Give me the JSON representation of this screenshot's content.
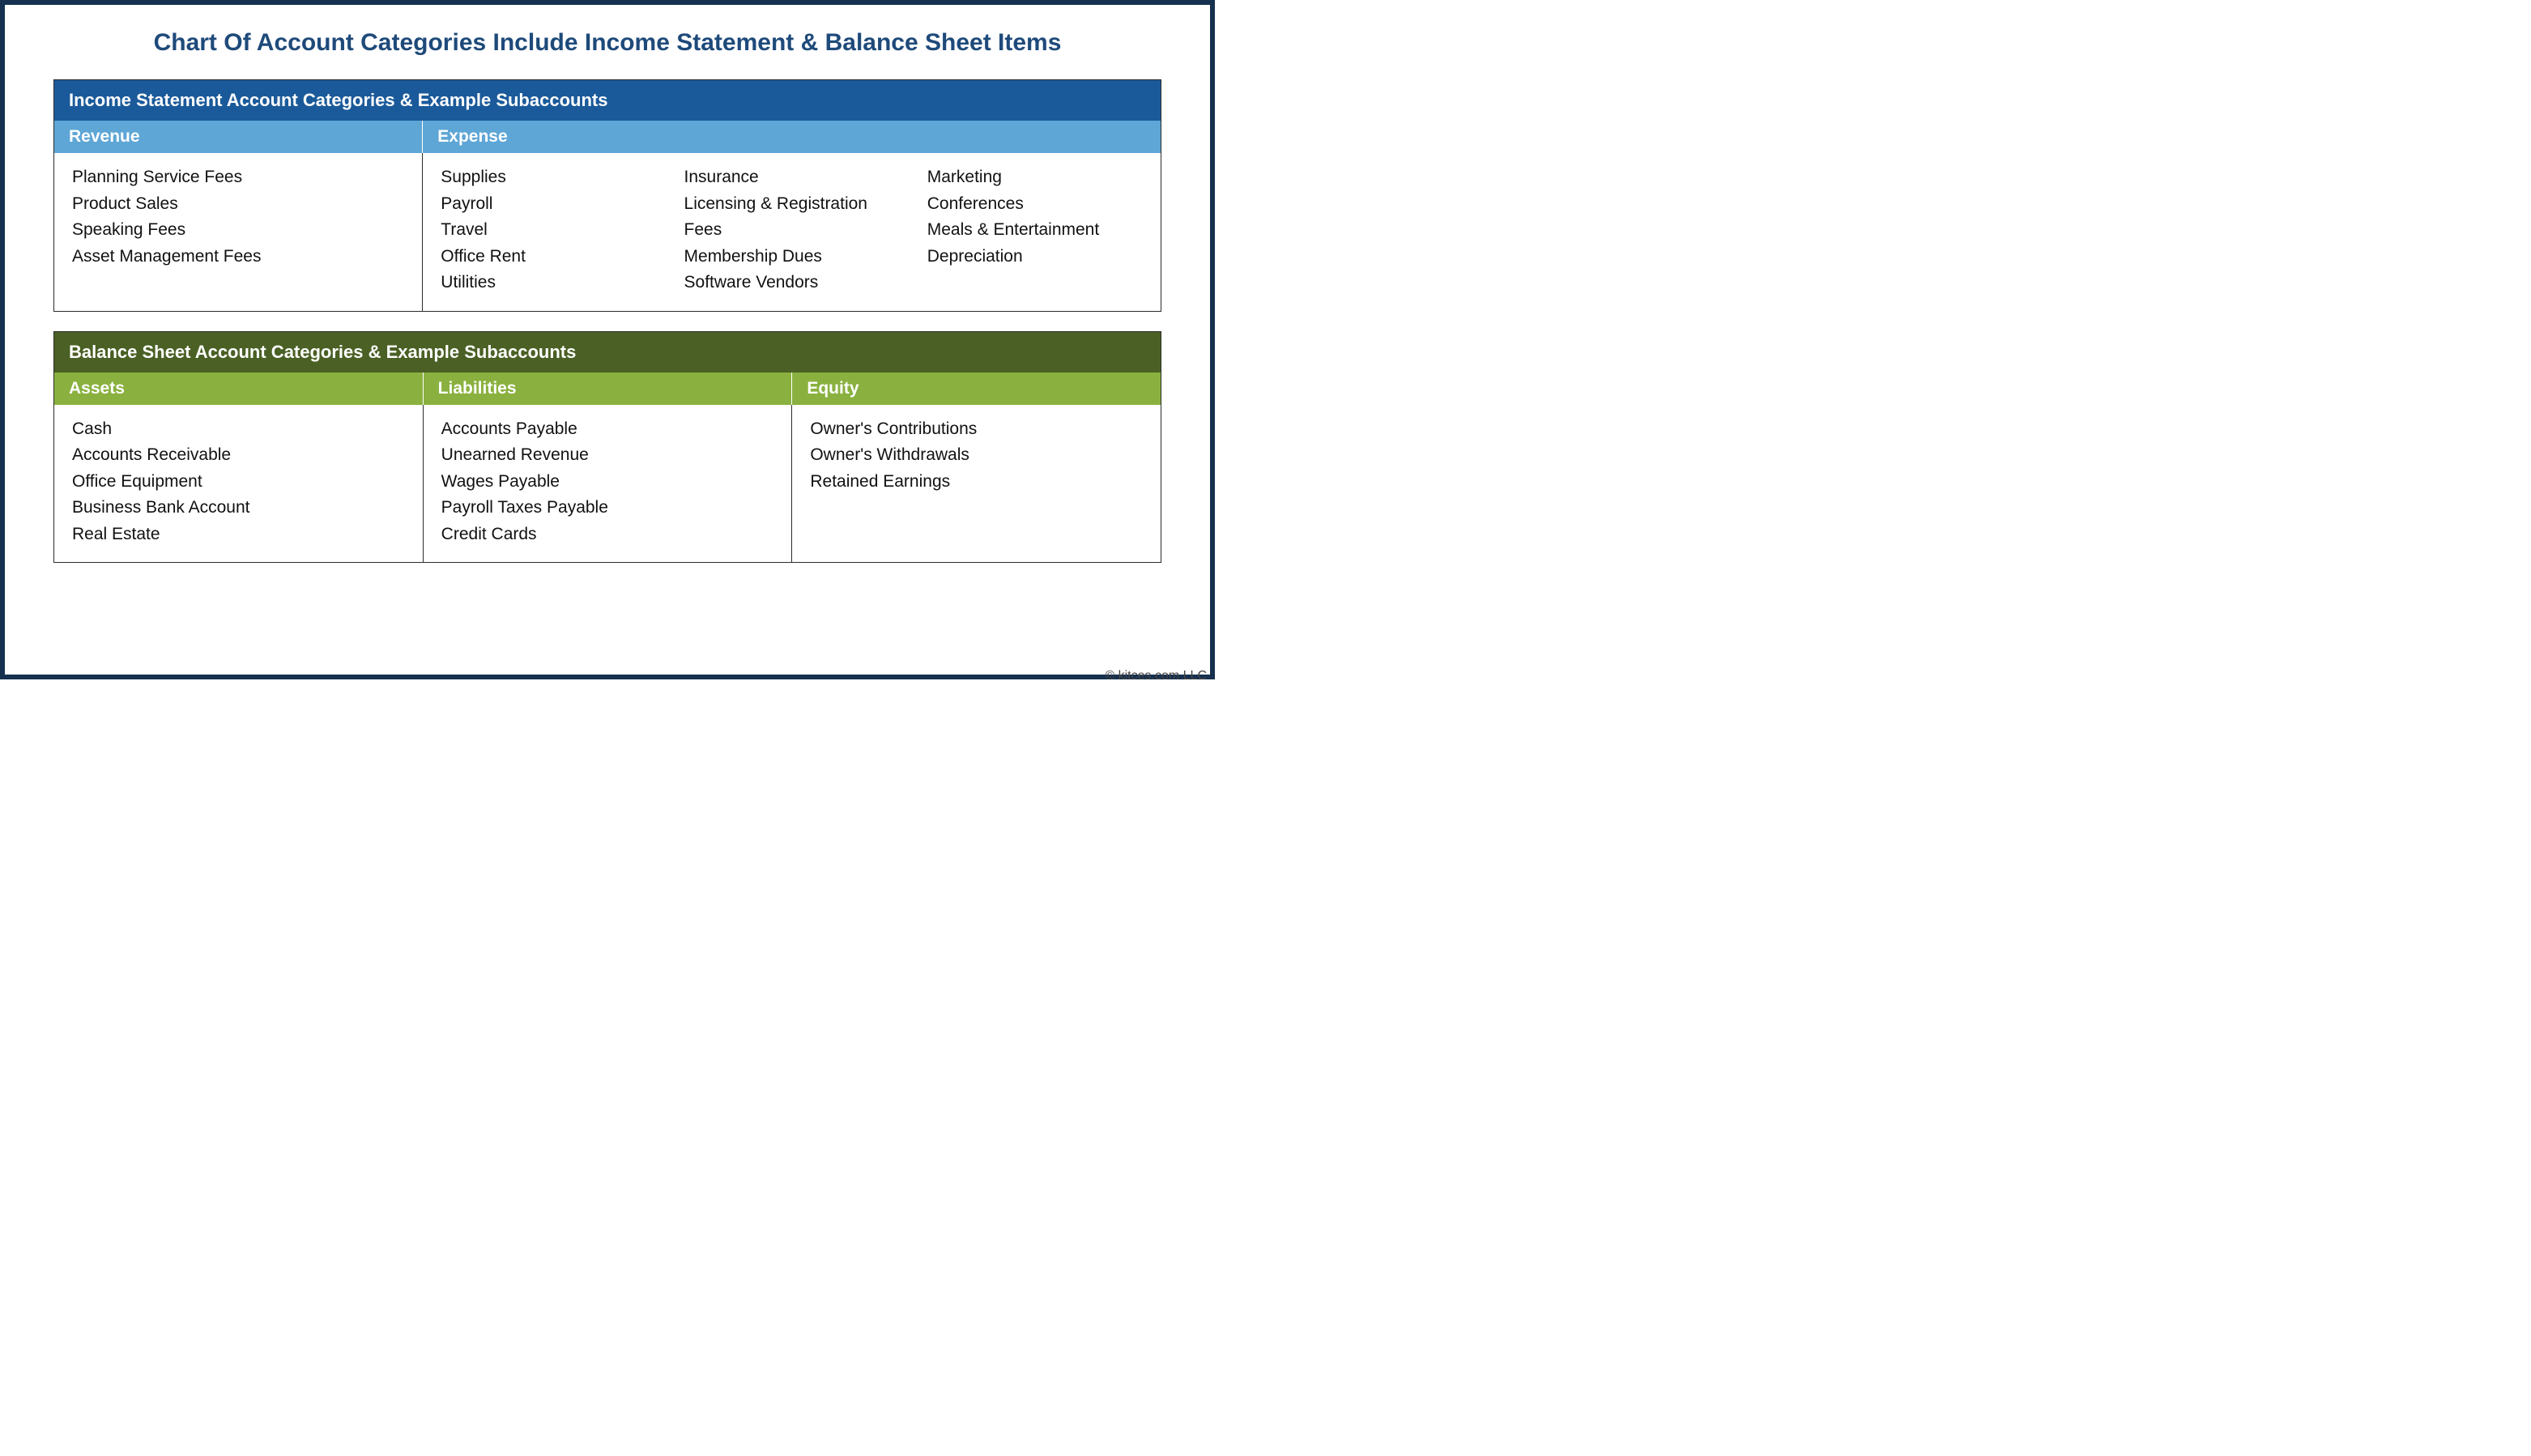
{
  "title": "Chart Of Account Categories Include Income Statement & Balance Sheet Items",
  "income_statement": {
    "header": "Income Statement Account Categories & Example Subaccounts",
    "revenue": {
      "label": "Revenue",
      "items": [
        "Planning Service Fees",
        "Product Sales",
        "Speaking Fees",
        "Asset Management Fees"
      ]
    },
    "expense": {
      "label": "Expense",
      "col1": [
        "Supplies",
        "Payroll",
        "Travel",
        "Office Rent",
        "Utilities"
      ],
      "col2": [
        "Insurance",
        "Licensing & Registration Fees",
        "Membership Dues",
        "Software Vendors"
      ],
      "col3": [
        "Marketing",
        "Conferences",
        "Meals & Entertainment",
        "Depreciation"
      ]
    }
  },
  "balance_sheet": {
    "header": "Balance Sheet Account Categories & Example Subaccounts",
    "assets": {
      "label": "Assets",
      "items": [
        "Cash",
        "Accounts Receivable",
        "Office Equipment",
        "Business Bank Account",
        "Real Estate"
      ]
    },
    "liabilities": {
      "label": "Liabilities",
      "items": [
        "Accounts Payable",
        "Unearned Revenue",
        "Wages Payable",
        "Payroll Taxes Payable",
        "Credit Cards"
      ]
    },
    "equity": {
      "label": "Equity",
      "items": [
        "Owner's Contributions",
        "Owner's Withdrawals",
        "Retained Earnings"
      ]
    }
  },
  "attribution": "© kitces.com LLC"
}
